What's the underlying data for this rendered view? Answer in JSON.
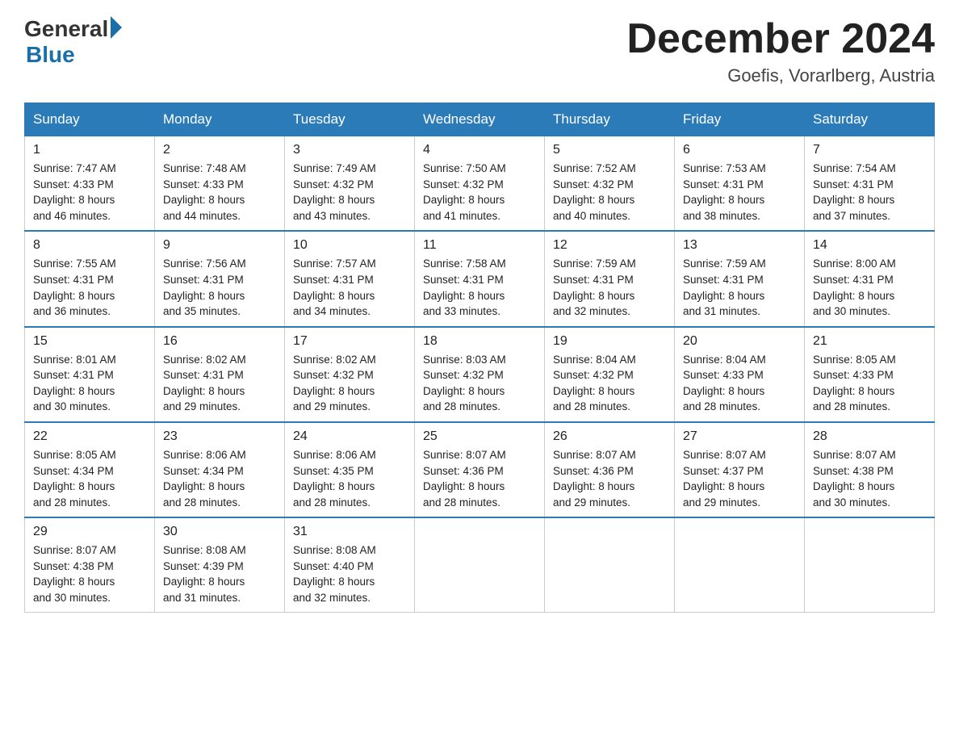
{
  "logo": {
    "general": "General",
    "blue": "Blue"
  },
  "header": {
    "month_year": "December 2024",
    "location": "Goefis, Vorarlberg, Austria"
  },
  "days_of_week": [
    "Sunday",
    "Monday",
    "Tuesday",
    "Wednesday",
    "Thursday",
    "Friday",
    "Saturday"
  ],
  "weeks": [
    [
      {
        "day": "1",
        "sunrise": "7:47 AM",
        "sunset": "4:33 PM",
        "daylight": "8 hours and 46 minutes."
      },
      {
        "day": "2",
        "sunrise": "7:48 AM",
        "sunset": "4:33 PM",
        "daylight": "8 hours and 44 minutes."
      },
      {
        "day": "3",
        "sunrise": "7:49 AM",
        "sunset": "4:32 PM",
        "daylight": "8 hours and 43 minutes."
      },
      {
        "day": "4",
        "sunrise": "7:50 AM",
        "sunset": "4:32 PM",
        "daylight": "8 hours and 41 minutes."
      },
      {
        "day": "5",
        "sunrise": "7:52 AM",
        "sunset": "4:32 PM",
        "daylight": "8 hours and 40 minutes."
      },
      {
        "day": "6",
        "sunrise": "7:53 AM",
        "sunset": "4:31 PM",
        "daylight": "8 hours and 38 minutes."
      },
      {
        "day": "7",
        "sunrise": "7:54 AM",
        "sunset": "4:31 PM",
        "daylight": "8 hours and 37 minutes."
      }
    ],
    [
      {
        "day": "8",
        "sunrise": "7:55 AM",
        "sunset": "4:31 PM",
        "daylight": "8 hours and 36 minutes."
      },
      {
        "day": "9",
        "sunrise": "7:56 AM",
        "sunset": "4:31 PM",
        "daylight": "8 hours and 35 minutes."
      },
      {
        "day": "10",
        "sunrise": "7:57 AM",
        "sunset": "4:31 PM",
        "daylight": "8 hours and 34 minutes."
      },
      {
        "day": "11",
        "sunrise": "7:58 AM",
        "sunset": "4:31 PM",
        "daylight": "8 hours and 33 minutes."
      },
      {
        "day": "12",
        "sunrise": "7:59 AM",
        "sunset": "4:31 PM",
        "daylight": "8 hours and 32 minutes."
      },
      {
        "day": "13",
        "sunrise": "7:59 AM",
        "sunset": "4:31 PM",
        "daylight": "8 hours and 31 minutes."
      },
      {
        "day": "14",
        "sunrise": "8:00 AM",
        "sunset": "4:31 PM",
        "daylight": "8 hours and 30 minutes."
      }
    ],
    [
      {
        "day": "15",
        "sunrise": "8:01 AM",
        "sunset": "4:31 PM",
        "daylight": "8 hours and 30 minutes."
      },
      {
        "day": "16",
        "sunrise": "8:02 AM",
        "sunset": "4:31 PM",
        "daylight": "8 hours and 29 minutes."
      },
      {
        "day": "17",
        "sunrise": "8:02 AM",
        "sunset": "4:32 PM",
        "daylight": "8 hours and 29 minutes."
      },
      {
        "day": "18",
        "sunrise": "8:03 AM",
        "sunset": "4:32 PM",
        "daylight": "8 hours and 28 minutes."
      },
      {
        "day": "19",
        "sunrise": "8:04 AM",
        "sunset": "4:32 PM",
        "daylight": "8 hours and 28 minutes."
      },
      {
        "day": "20",
        "sunrise": "8:04 AM",
        "sunset": "4:33 PM",
        "daylight": "8 hours and 28 minutes."
      },
      {
        "day": "21",
        "sunrise": "8:05 AM",
        "sunset": "4:33 PM",
        "daylight": "8 hours and 28 minutes."
      }
    ],
    [
      {
        "day": "22",
        "sunrise": "8:05 AM",
        "sunset": "4:34 PM",
        "daylight": "8 hours and 28 minutes."
      },
      {
        "day": "23",
        "sunrise": "8:06 AM",
        "sunset": "4:34 PM",
        "daylight": "8 hours and 28 minutes."
      },
      {
        "day": "24",
        "sunrise": "8:06 AM",
        "sunset": "4:35 PM",
        "daylight": "8 hours and 28 minutes."
      },
      {
        "day": "25",
        "sunrise": "8:07 AM",
        "sunset": "4:36 PM",
        "daylight": "8 hours and 28 minutes."
      },
      {
        "day": "26",
        "sunrise": "8:07 AM",
        "sunset": "4:36 PM",
        "daylight": "8 hours and 29 minutes."
      },
      {
        "day": "27",
        "sunrise": "8:07 AM",
        "sunset": "4:37 PM",
        "daylight": "8 hours and 29 minutes."
      },
      {
        "day": "28",
        "sunrise": "8:07 AM",
        "sunset": "4:38 PM",
        "daylight": "8 hours and 30 minutes."
      }
    ],
    [
      {
        "day": "29",
        "sunrise": "8:07 AM",
        "sunset": "4:38 PM",
        "daylight": "8 hours and 30 minutes."
      },
      {
        "day": "30",
        "sunrise": "8:08 AM",
        "sunset": "4:39 PM",
        "daylight": "8 hours and 31 minutes."
      },
      {
        "day": "31",
        "sunrise": "8:08 AM",
        "sunset": "4:40 PM",
        "daylight": "8 hours and 32 minutes."
      },
      null,
      null,
      null,
      null
    ]
  ],
  "labels": {
    "sunrise": "Sunrise:",
    "sunset": "Sunset:",
    "daylight": "Daylight:"
  }
}
